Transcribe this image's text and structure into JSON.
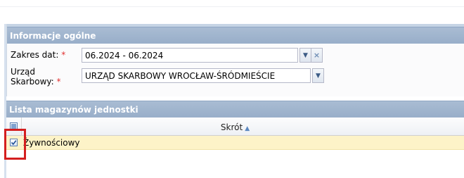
{
  "general_panel": {
    "title": "Informacje ogólne",
    "date_range": {
      "label": "Zakres dat:",
      "required_mark": "*",
      "value": "06.2024 - 06.2024"
    },
    "tax_office": {
      "label_line1": "Urząd",
      "label_line2": "Skarbowy:",
      "required_mark": "*",
      "value": "URZĄD SKARBOWY WROCŁAW-ŚRÓDMIEŚCIE"
    }
  },
  "list_panel": {
    "title": "Lista magazynów jednostki",
    "columns": [
      {
        "label": "Skrót",
        "sort": "ascending"
      }
    ],
    "rows": [
      {
        "text": "Żywnościowy",
        "checked": true
      }
    ]
  },
  "colors": {
    "panel_header": "#a9bcd3",
    "selected_row": "#fdf3c8",
    "required": "#e03030",
    "highlight_border": "#d41f1f"
  }
}
